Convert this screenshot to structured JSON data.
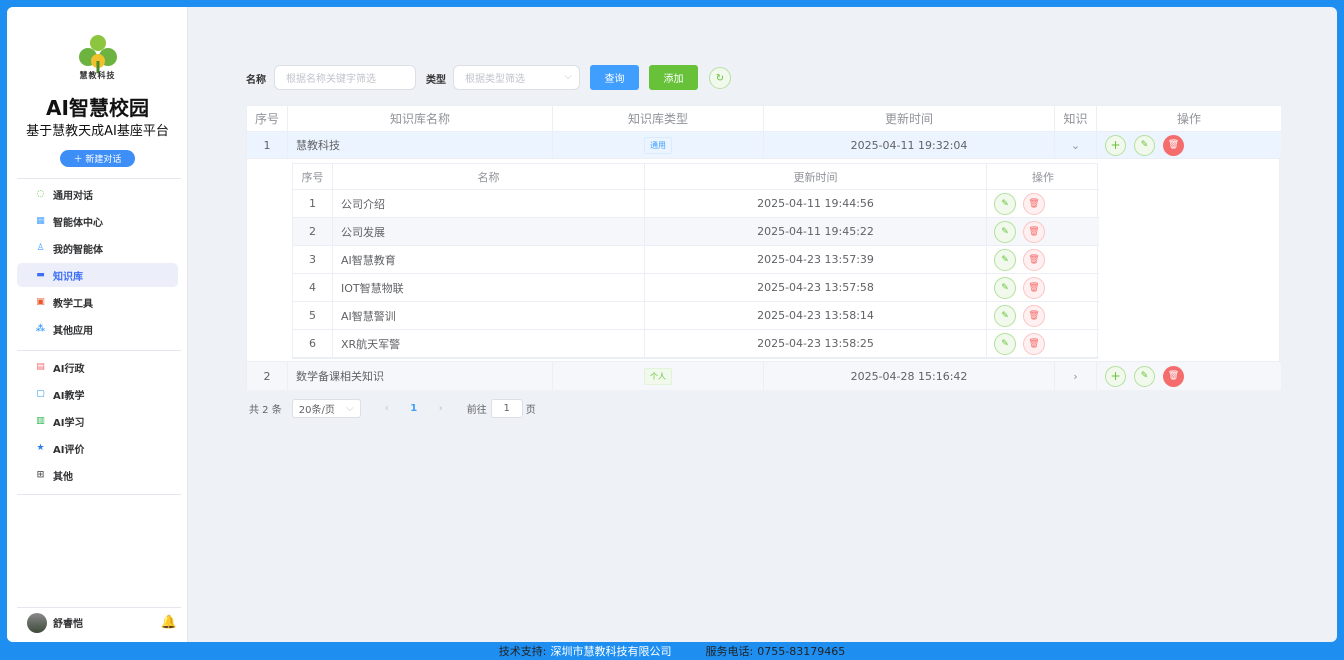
{
  "sidebar": {
    "logo_text": "慧教科技",
    "app_title": "AI智慧校园",
    "app_subtitle": "基于慧教天成AI基座平台",
    "new_chat": "＋ 新建对话",
    "nav_group1": [
      {
        "label": "通用对话",
        "icon": "chat-icon"
      },
      {
        "label": "智能体中心",
        "icon": "grid-icon"
      },
      {
        "label": "我的智能体",
        "icon": "user-icon"
      },
      {
        "label": "知识库",
        "icon": "book-icon",
        "active": true
      },
      {
        "label": "教学工具",
        "icon": "ppt-icon"
      },
      {
        "label": "其他应用",
        "icon": "apps-icon"
      }
    ],
    "nav_group2": [
      {
        "label": "AI行政",
        "icon": "admin-icon"
      },
      {
        "label": "AI教学",
        "icon": "teach-icon"
      },
      {
        "label": "AI学习",
        "icon": "study-icon"
      },
      {
        "label": "AI评价",
        "icon": "star-icon"
      },
      {
        "label": "其他",
        "icon": "more-icon"
      }
    ],
    "user_name": "舒睿恺"
  },
  "filters": {
    "name_label": "名称",
    "name_placeholder": "根据名称关键字筛选",
    "type_label": "类型",
    "type_placeholder": "根据类型筛选",
    "query_btn": "查询",
    "add_btn": "添加"
  },
  "table": {
    "headers": [
      "序号",
      "知识库名称",
      "知识库类型",
      "更新时间",
      "知识",
      "操作"
    ],
    "rows": [
      {
        "index": "1",
        "name": "慧教科技",
        "type": "通用",
        "updated": "2025-04-11 19:32:04",
        "expanded": true
      },
      {
        "index": "2",
        "name": "数学备课相关知识",
        "type": "个人",
        "updated": "2025-04-28 15:16:42",
        "expanded": false
      }
    ]
  },
  "sub_table": {
    "headers": [
      "序号",
      "名称",
      "更新时间",
      "操作"
    ],
    "rows": [
      {
        "index": "1",
        "name": "公司介绍",
        "updated": "2025-04-11 19:44:56"
      },
      {
        "index": "2",
        "name": "公司发展",
        "updated": "2025-04-11 19:45:22"
      },
      {
        "index": "3",
        "name": "AI智慧教育",
        "updated": "2025-04-23 13:57:39"
      },
      {
        "index": "4",
        "name": "IOT智慧物联",
        "updated": "2025-04-23 13:57:58"
      },
      {
        "index": "5",
        "name": "AI智慧警训",
        "updated": "2025-04-23 13:58:14"
      },
      {
        "index": "6",
        "name": "XR航天军警",
        "updated": "2025-04-23 13:58:25"
      }
    ]
  },
  "pager": {
    "total": "共 2 条",
    "page_size": "20条/页",
    "current": "1",
    "goto_label": "前往",
    "goto_value": "1",
    "page_unit": "页"
  },
  "footer": {
    "support_label": "技术支持:",
    "support_company": "深圳市慧教科技有限公司",
    "phone_label": "服务电话:",
    "phone": "0755-83179465"
  }
}
